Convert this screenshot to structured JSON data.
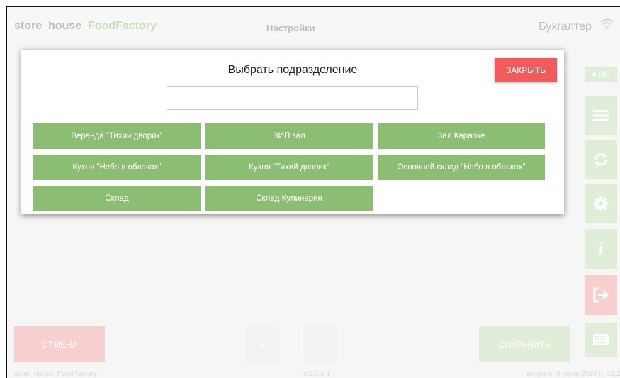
{
  "header": {
    "brand_main": "store_house_",
    "brand_accent": "FoodFactory",
    "screen_title": "Настройки",
    "user": "Бухгалтер"
  },
  "right_panel": {
    "language": "RU"
  },
  "modal": {
    "title": "Выбрать подразделение",
    "close_label": "ЗАКРЫТЬ",
    "search_value": "",
    "departments": [
      "Веранда \"Тихий дворик\"",
      "ВИП зал",
      "Зал Караоке",
      "Кухня \"Небо в облаках\"",
      "Кухня \"Тихий дворик\"",
      "Основной склад \"Небо в облаках\"",
      "Склад",
      "Склад Кулинария"
    ]
  },
  "bottom": {
    "cancel_label": "ОТМЕНА",
    "save_label": "СОХРАНИТЬ",
    "prev_label": "‹",
    "next_label": "›"
  },
  "footer": {
    "app_name": "store_house_FoodFactory",
    "version": "v.1.0.3-1",
    "datetime": "вторник, 9 июля 2019 г., 13:21"
  },
  "colors": {
    "primary_green": "#8bbd73",
    "close_red": "#f25b5b",
    "faded_green": "#d0e4c4",
    "faded_red": "#f4b6b6"
  }
}
